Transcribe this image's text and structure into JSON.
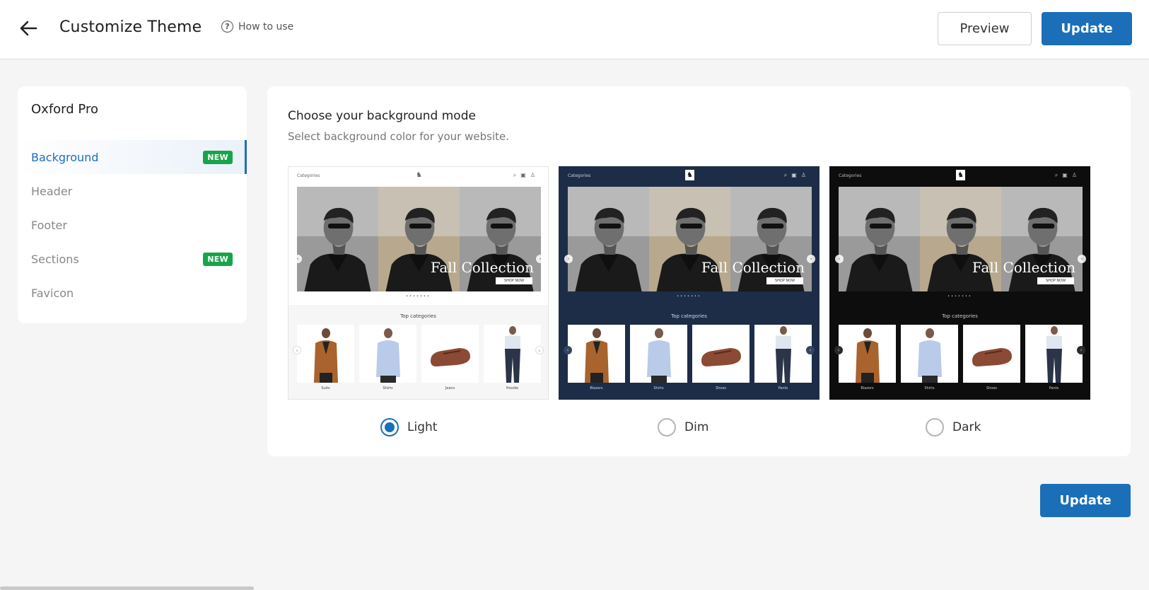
{
  "header": {
    "title": "Customize Theme",
    "how_to_use": "How to use",
    "preview_label": "Preview",
    "update_label": "Update"
  },
  "sidebar": {
    "theme_name": "Oxford Pro",
    "items": [
      {
        "label": "Background",
        "badge": "NEW",
        "active": true
      },
      {
        "label": "Header",
        "badge": ""
      },
      {
        "label": "Footer",
        "badge": ""
      },
      {
        "label": "Sections",
        "badge": "NEW"
      },
      {
        "label": "Favicon",
        "badge": ""
      }
    ]
  },
  "main": {
    "title": "Choose your background mode",
    "subtitle": "Select background color for your website.",
    "selected_mode": "Light",
    "modes": [
      {
        "label": "Light",
        "nav_label": "Categories",
        "hero_text": "Fall Collection",
        "hero_button": "SHOP NOW",
        "section_title": "Top categories",
        "categories": [
          "Suits",
          "Shirts",
          "Jeans",
          "Hoodie"
        ]
      },
      {
        "label": "Dim",
        "nav_label": "Categories",
        "hero_text": "Fall Collection",
        "hero_button": "SHOP NOW",
        "section_title": "Top categories",
        "categories": [
          "Blazers",
          "Shirts",
          "Shoes",
          "Pants"
        ]
      },
      {
        "label": "Dark",
        "nav_label": "Categories",
        "hero_text": "Fall Collection",
        "hero_button": "SHOP NOW",
        "section_title": "Top categories",
        "categories": [
          "Blazers",
          "Shirts",
          "Shoes",
          "Pants"
        ]
      }
    ]
  },
  "footer": {
    "update_label": "Update"
  },
  "colors": {
    "accent": "#1a6fb8",
    "badge": "#18a44a",
    "dim_bg": "#1d2d48",
    "dark_bg": "#0d0d0d"
  },
  "icons": {
    "back": "arrow-left-icon",
    "help": "question-circle-icon"
  }
}
